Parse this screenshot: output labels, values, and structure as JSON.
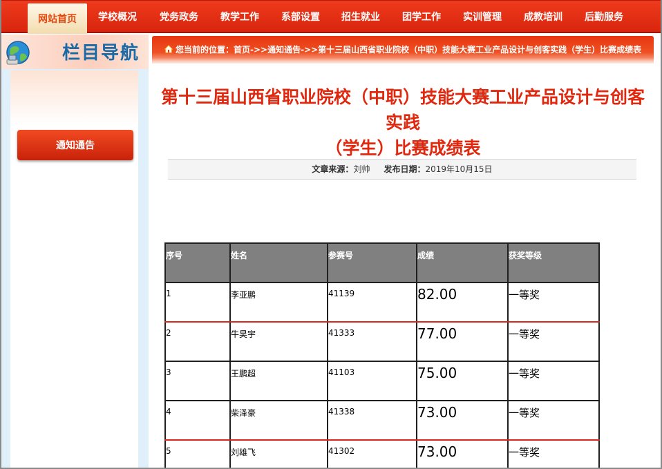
{
  "nav": {
    "home": "网站首页",
    "items": [
      "学校概况",
      "党务政务",
      "教学工作",
      "系部设置",
      "招生就业",
      "团学工作",
      "实训管理",
      "成教培训",
      "后勤服务"
    ]
  },
  "sidebar": {
    "title": "栏目导航",
    "items": [
      {
        "label": "通知通告"
      }
    ]
  },
  "breadcrumb": {
    "text": "您当前的位置：首页->>通知通告->>第十三届山西省职业院校（中职）技能大赛工业产品设计与创客实践（学生）比赛成绩表"
  },
  "article": {
    "title_line1": "第十三届山西省职业院校（中职）技能大赛工业产品设计与创客实践",
    "title_line2": "（学生）比赛成绩表",
    "source_label": "文章来源：",
    "source": "刘帅",
    "date_label": "发布日期：",
    "date": "2019年10月15日"
  },
  "table": {
    "headers": [
      "序号",
      "姓名",
      "参赛号",
      "成绩",
      "获奖等级"
    ],
    "rows": [
      {
        "no": "1",
        "name": "李亚鹏",
        "id": "41139",
        "score": "82.00",
        "award": "一等奖"
      },
      {
        "no": "2",
        "name": "牛昊宇",
        "id": "41333",
        "score": "77.00",
        "award": "一等奖"
      },
      {
        "no": "3",
        "name": "王鹏超",
        "id": "41103",
        "score": "75.00",
        "award": "一等奖"
      },
      {
        "no": "4",
        "name": "柴泽豪",
        "id": "41338",
        "score": "73.00",
        "award": "一等奖"
      },
      {
        "no": "5",
        "name": "刘雄飞",
        "id": "41302",
        "score": "73.00",
        "award": "一等奖"
      }
    ]
  },
  "colors": {
    "nav_red": "#e0300f",
    "title_red": "#e0280f",
    "sidebar_blue": "#1a6aa8",
    "table_header": "#808080"
  },
  "icons": [
    "globe-icon",
    "house-icon"
  ]
}
